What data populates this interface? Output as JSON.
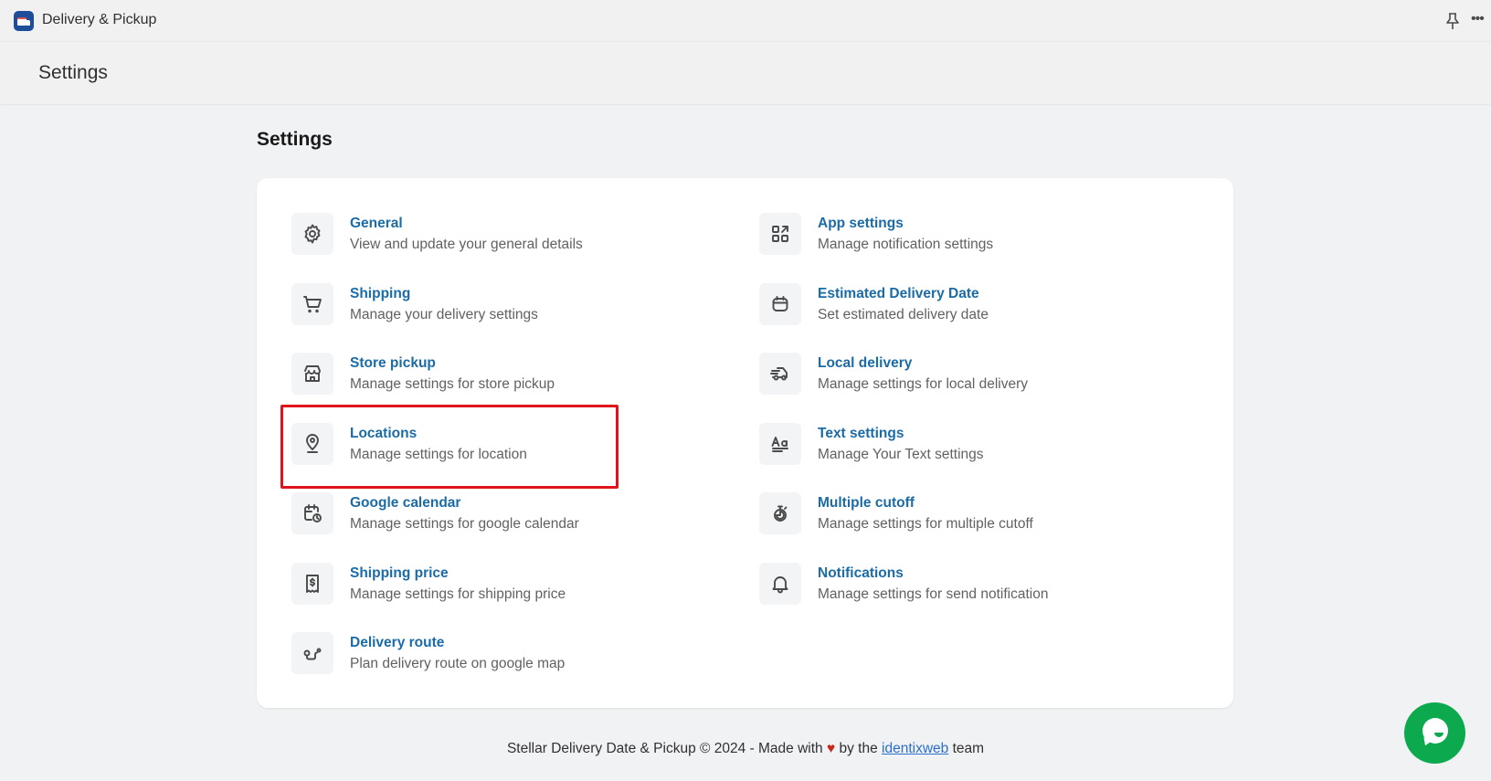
{
  "app": {
    "title": "Delivery & Pickup",
    "icon": "delivery-truck-icon",
    "header_actions": [
      {
        "name": "pin",
        "icon": "pin-icon"
      },
      {
        "name": "more",
        "icon": "more-horizontal-icon",
        "glyph": "•••"
      }
    ]
  },
  "page_header": {
    "title": "Settings"
  },
  "section": {
    "title": "Settings"
  },
  "settings": {
    "left": [
      {
        "title": "General",
        "description": "View and update your general details",
        "icon": "gear-icon"
      },
      {
        "title": "Shipping",
        "description": "Manage your delivery settings",
        "icon": "cart-icon"
      },
      {
        "title": "Store pickup",
        "description": "Manage settings for store pickup",
        "icon": "store-icon"
      },
      {
        "title": "Locations",
        "description": "Manage settings for location",
        "icon": "location-pin-icon",
        "highlighted": true
      },
      {
        "title": "Google calendar",
        "description": "Manage settings for google calendar",
        "icon": "calendar-clock-icon"
      },
      {
        "title": "Shipping price",
        "description": "Manage settings for shipping price",
        "icon": "receipt-dollar-icon"
      },
      {
        "title": "Delivery route",
        "description": "Plan delivery route on google map",
        "icon": "route-icon"
      }
    ],
    "right": [
      {
        "title": "App settings",
        "description": "Manage notification settings",
        "icon": "apps-icon"
      },
      {
        "title": "Estimated Delivery Date",
        "description": "Set estimated delivery date",
        "icon": "calendar-icon"
      },
      {
        "title": "Local delivery",
        "description": "Manage settings for local delivery",
        "icon": "delivery-truck-icon"
      },
      {
        "title": "Text settings",
        "description": "Manage Your Text settings",
        "icon": "text-format-icon"
      },
      {
        "title": "Multiple cutoff",
        "description": "Manage settings for multiple cutoff",
        "icon": "stopwatch-icon"
      },
      {
        "title": "Notifications",
        "description": "Manage settings for send notification",
        "icon": "bell-icon"
      }
    ]
  },
  "footer": {
    "prefix": "Stellar Delivery Date & Pickup © 2024 - Made with",
    "heart": "♥",
    "middle": "by the",
    "link": "identixweb",
    "suffix": "team"
  },
  "colors": {
    "link": "#1b6ba6",
    "highlight": "#e0141b",
    "chat": "#0ca94f",
    "app_icon": "#1e4d9a"
  },
  "chat": {
    "icon": "chat-bubble-icon"
  }
}
